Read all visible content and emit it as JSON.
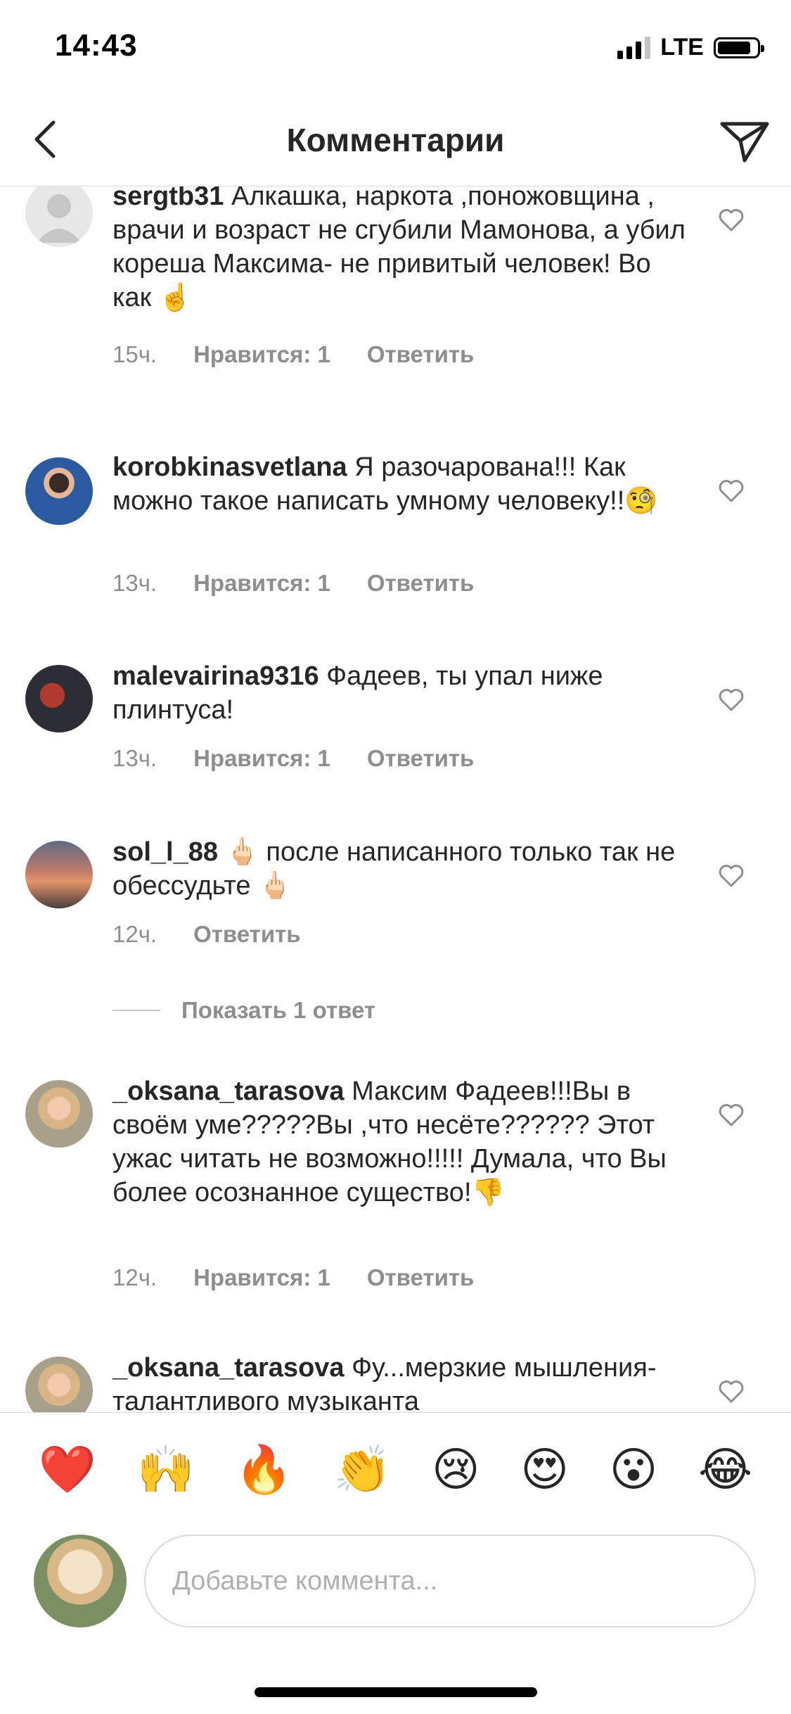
{
  "status_bar": {
    "time": "14:43",
    "network": "LTE"
  },
  "nav": {
    "title": "Комментарии",
    "back_icon": "chevron-left-icon",
    "send_icon": "paper-plane-icon"
  },
  "comments": [
    {
      "username": "sergtb31",
      "text": "Алкашка, наркота ,поножовщина , врачи и возраст не сгубили Мамонова, а убил кореша Максима- не привитый человек! Во как ☝️",
      "time": "15ч.",
      "likes": "Нравится: 1",
      "reply": "Ответить"
    },
    {
      "username": "korobkinasvetlana",
      "text": "Я разочарована!!! Как можно такое написать умному человеку!!🧐",
      "time": "13ч.",
      "likes": "Нравится: 1",
      "reply": "Ответить"
    },
    {
      "username": "malevairina9316",
      "text": "Фадеев, ты упал ниже плинтуса!",
      "time": "13ч.",
      "likes": "Нравится: 1",
      "reply": "Ответить"
    },
    {
      "username": "sol_l_88",
      "text": "🖕🏻 после написанного только так не обессудьте 🖕🏻",
      "time": "12ч.",
      "reply": "Ответить",
      "show_replies": "Показать 1 ответ"
    },
    {
      "username": "_oksana_tarasova",
      "text": "Максим Фадеев!!!Вы в своём уме?????Вы ,что несёте?????? Этот ужас читать не возможно!!!!! Думала, что Вы более осознанное существо!👎",
      "time": "12ч.",
      "likes": "Нравится: 1",
      "reply": "Ответить"
    },
    {
      "username": "_oksana_tarasova",
      "text": "Фу...мерзкие мышления- талантливого музыканта"
    }
  ],
  "emoji_bar": [
    "❤️",
    "🙌",
    "🔥",
    "👏",
    "😢",
    "😍",
    "😮",
    "😂"
  ],
  "composer": {
    "placeholder": "Добавьте коммента..."
  },
  "colors": {
    "text": "#262626",
    "meta": "#8e8e8e",
    "divider": "#dbdbdb",
    "heart": "#8e8e8e"
  }
}
